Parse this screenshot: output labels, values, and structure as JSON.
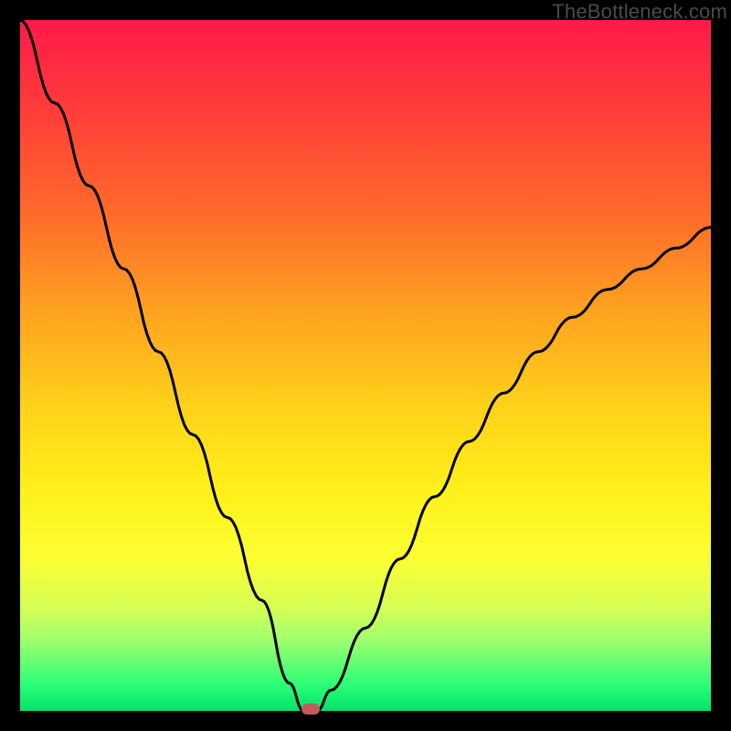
{
  "watermark": "TheBottleneck.com",
  "chart_data": {
    "type": "line",
    "title": "",
    "xlabel": "",
    "ylabel": "",
    "xlim": [
      0,
      100
    ],
    "ylim": [
      0,
      100
    ],
    "series": [
      {
        "name": "bottleneck-curve",
        "x": [
          0,
          5,
          10,
          15,
          20,
          25,
          30,
          35,
          39,
          41,
          43,
          45,
          50,
          55,
          60,
          65,
          70,
          75,
          80,
          85,
          90,
          95,
          100
        ],
        "values": [
          100,
          88,
          76,
          64,
          52,
          40,
          28,
          16,
          4,
          0,
          0,
          3,
          12,
          22,
          31,
          39,
          46,
          52,
          57,
          61,
          64,
          67,
          70
        ]
      }
    ],
    "marker": {
      "x": 42,
      "y": 0
    },
    "background_gradient": {
      "top": "#ff1a49",
      "mid_upper": "#ffa220",
      "mid": "#fff01a",
      "mid_lower": "#9cff70",
      "bottom": "#00e46a"
    }
  }
}
